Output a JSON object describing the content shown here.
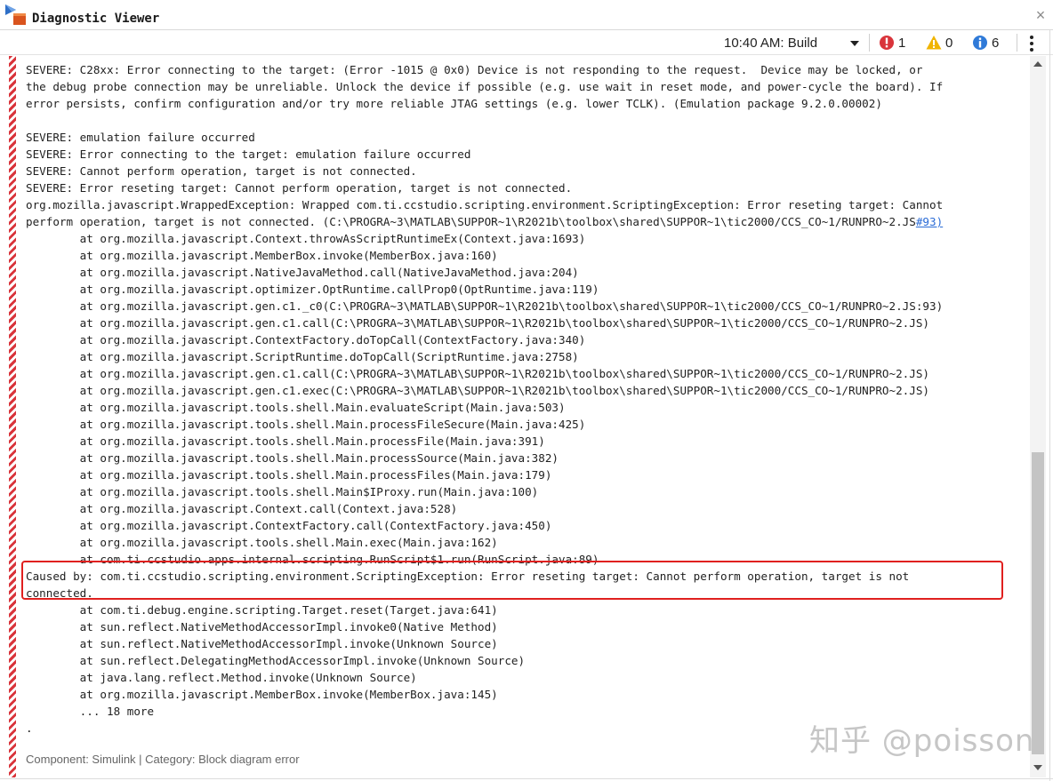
{
  "window": {
    "title": "Diagnostic Viewer",
    "close_symbol": "×"
  },
  "toolbar": {
    "build_label": "10:40 AM: Build",
    "error_count": "1",
    "warning_count": "0",
    "info_count": "6"
  },
  "log_lines": [
    "SEVERE: C28xx: Error connecting to the target: (Error -1015 @ 0x0) Device is not responding to the request.  Device may be locked, or",
    "the debug probe connection may be unreliable. Unlock the device if possible (e.g. use wait in reset mode, and power-cycle the board). If",
    "error persists, confirm configuration and/or try more reliable JTAG settings (e.g. lower TCLK). (Emulation package 9.2.0.00002)",
    "",
    "SEVERE: emulation failure occurred",
    "SEVERE: Error connecting to the target: emulation failure occurred",
    "SEVERE: Cannot perform operation, target is not connected.",
    "SEVERE: Error reseting target: Cannot perform operation, target is not connected.",
    "org.mozilla.javascript.WrappedException: Wrapped com.ti.ccstudio.scripting.environment.ScriptingException: Error reseting target: Cannot",
    "perform operation, target is not connected. (C:\\PROGRA~3\\MATLAB\\SUPPOR~1\\R2021b\\toolbox\\shared\\SUPPOR~1\\tic2000/CCS_CO~1/RUNPRO~2.JS",
    "        at org.mozilla.javascript.Context.throwAsScriptRuntimeEx(Context.java:1693)",
    "        at org.mozilla.javascript.MemberBox.invoke(MemberBox.java:160)",
    "        at org.mozilla.javascript.NativeJavaMethod.call(NativeJavaMethod.java:204)",
    "        at org.mozilla.javascript.optimizer.OptRuntime.callProp0(OptRuntime.java:119)",
    "        at org.mozilla.javascript.gen.c1._c0(C:\\PROGRA~3\\MATLAB\\SUPPOR~1\\R2021b\\toolbox\\shared\\SUPPOR~1\\tic2000/CCS_CO~1/RUNPRO~2.JS:93)",
    "        at org.mozilla.javascript.gen.c1.call(C:\\PROGRA~3\\MATLAB\\SUPPOR~1\\R2021b\\toolbox\\shared\\SUPPOR~1\\tic2000/CCS_CO~1/RUNPRO~2.JS)",
    "        at org.mozilla.javascript.ContextFactory.doTopCall(ContextFactory.java:340)",
    "        at org.mozilla.javascript.ScriptRuntime.doTopCall(ScriptRuntime.java:2758)",
    "        at org.mozilla.javascript.gen.c1.call(C:\\PROGRA~3\\MATLAB\\SUPPOR~1\\R2021b\\toolbox\\shared\\SUPPOR~1\\tic2000/CCS_CO~1/RUNPRO~2.JS)",
    "        at org.mozilla.javascript.gen.c1.exec(C:\\PROGRA~3\\MATLAB\\SUPPOR~1\\R2021b\\toolbox\\shared\\SUPPOR~1\\tic2000/CCS_CO~1/RUNPRO~2.JS)",
    "        at org.mozilla.javascript.tools.shell.Main.evaluateScript(Main.java:503)",
    "        at org.mozilla.javascript.tools.shell.Main.processFileSecure(Main.java:425)",
    "        at org.mozilla.javascript.tools.shell.Main.processFile(Main.java:391)",
    "        at org.mozilla.javascript.tools.shell.Main.processSource(Main.java:382)",
    "        at org.mozilla.javascript.tools.shell.Main.processFiles(Main.java:179)",
    "        at org.mozilla.javascript.tools.shell.Main$IProxy.run(Main.java:100)",
    "        at org.mozilla.javascript.Context.call(Context.java:528)",
    "        at org.mozilla.javascript.ContextFactory.call(ContextFactory.java:450)",
    "        at org.mozilla.javascript.tools.shell.Main.exec(Main.java:162)",
    "        at com.ti.ccstudio.apps.internal.scripting.RunScript$1.run(RunScript.java:89)",
    "Caused by: com.ti.ccstudio.scripting.environment.ScriptingException: Error reseting target: Cannot perform operation, target is not",
    "connected.",
    "        at com.ti.debug.engine.scripting.Target.reset(Target.java:641)",
    "        at sun.reflect.NativeMethodAccessorImpl.invoke0(Native Method)",
    "        at sun.reflect.NativeMethodAccessorImpl.invoke(Unknown Source)",
    "        at sun.reflect.DelegatingMethodAccessorImpl.invoke(Unknown Source)",
    "        at java.lang.reflect.Method.invoke(Unknown Source)",
    "        at org.mozilla.javascript.MemberBox.invoke(MemberBox.java:145)",
    "        ... 18 more",
    "."
  ],
  "link_text": "#93)",
  "footer": "Component:  Simulink | Category:  Block diagram error",
  "watermark": "知乎 @poisson",
  "colors": {
    "error": "#d9343b",
    "warning": "#f0b400",
    "info": "#2f7ad8",
    "highlight_box": "#e0201f"
  }
}
